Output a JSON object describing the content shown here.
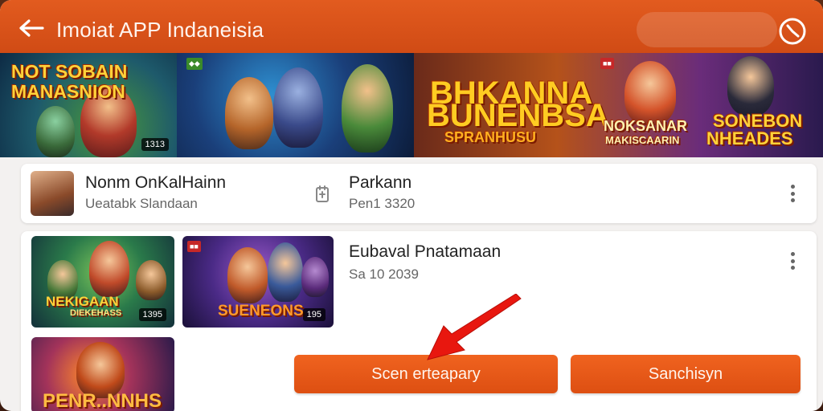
{
  "app": {
    "title": "Imoiat APP Indaneisia"
  },
  "banner": {
    "tile1": {
      "line1": "NOT SOBAIN",
      "line2": "MANASNION",
      "badge": "1313"
    },
    "tile2": {
      "badge": ""
    },
    "tile3": {
      "title1": "BHKANNA",
      "title2": "BUNENBSA",
      "sub": "SPRANHUSU",
      "middle1": "NOKSANAR",
      "middle2": "MAKISCAARIN",
      "right1": "SONEBON",
      "right2": "NHEADES"
    }
  },
  "card1": {
    "name": "Nonm OnKalHainn",
    "subtitle": "Ueatabk Slandaan",
    "name2": "Parkann",
    "subtitle2": "Pen1 3320"
  },
  "card2": {
    "title": "Eubaval Pnatamaan",
    "subtitle": "Sa 10 2039",
    "thumbs": [
      {
        "line1": "NEKIGAAN",
        "line2": "DIEKEHASS",
        "badge": "1395"
      },
      {
        "line1": "SUENEONS",
        "badge": "195"
      },
      {
        "line1": "PENR..NNHS"
      }
    ],
    "button_primary": "Scen erteapary",
    "button_secondary": "Sanchisyn"
  },
  "colors": {
    "accent": "#e25b1f",
    "button": "#ea5a18",
    "arrow": "#e8170f"
  },
  "icons": [
    "back-arrow-icon",
    "clock-icon",
    "phone-icon",
    "more-vert-icon"
  ]
}
